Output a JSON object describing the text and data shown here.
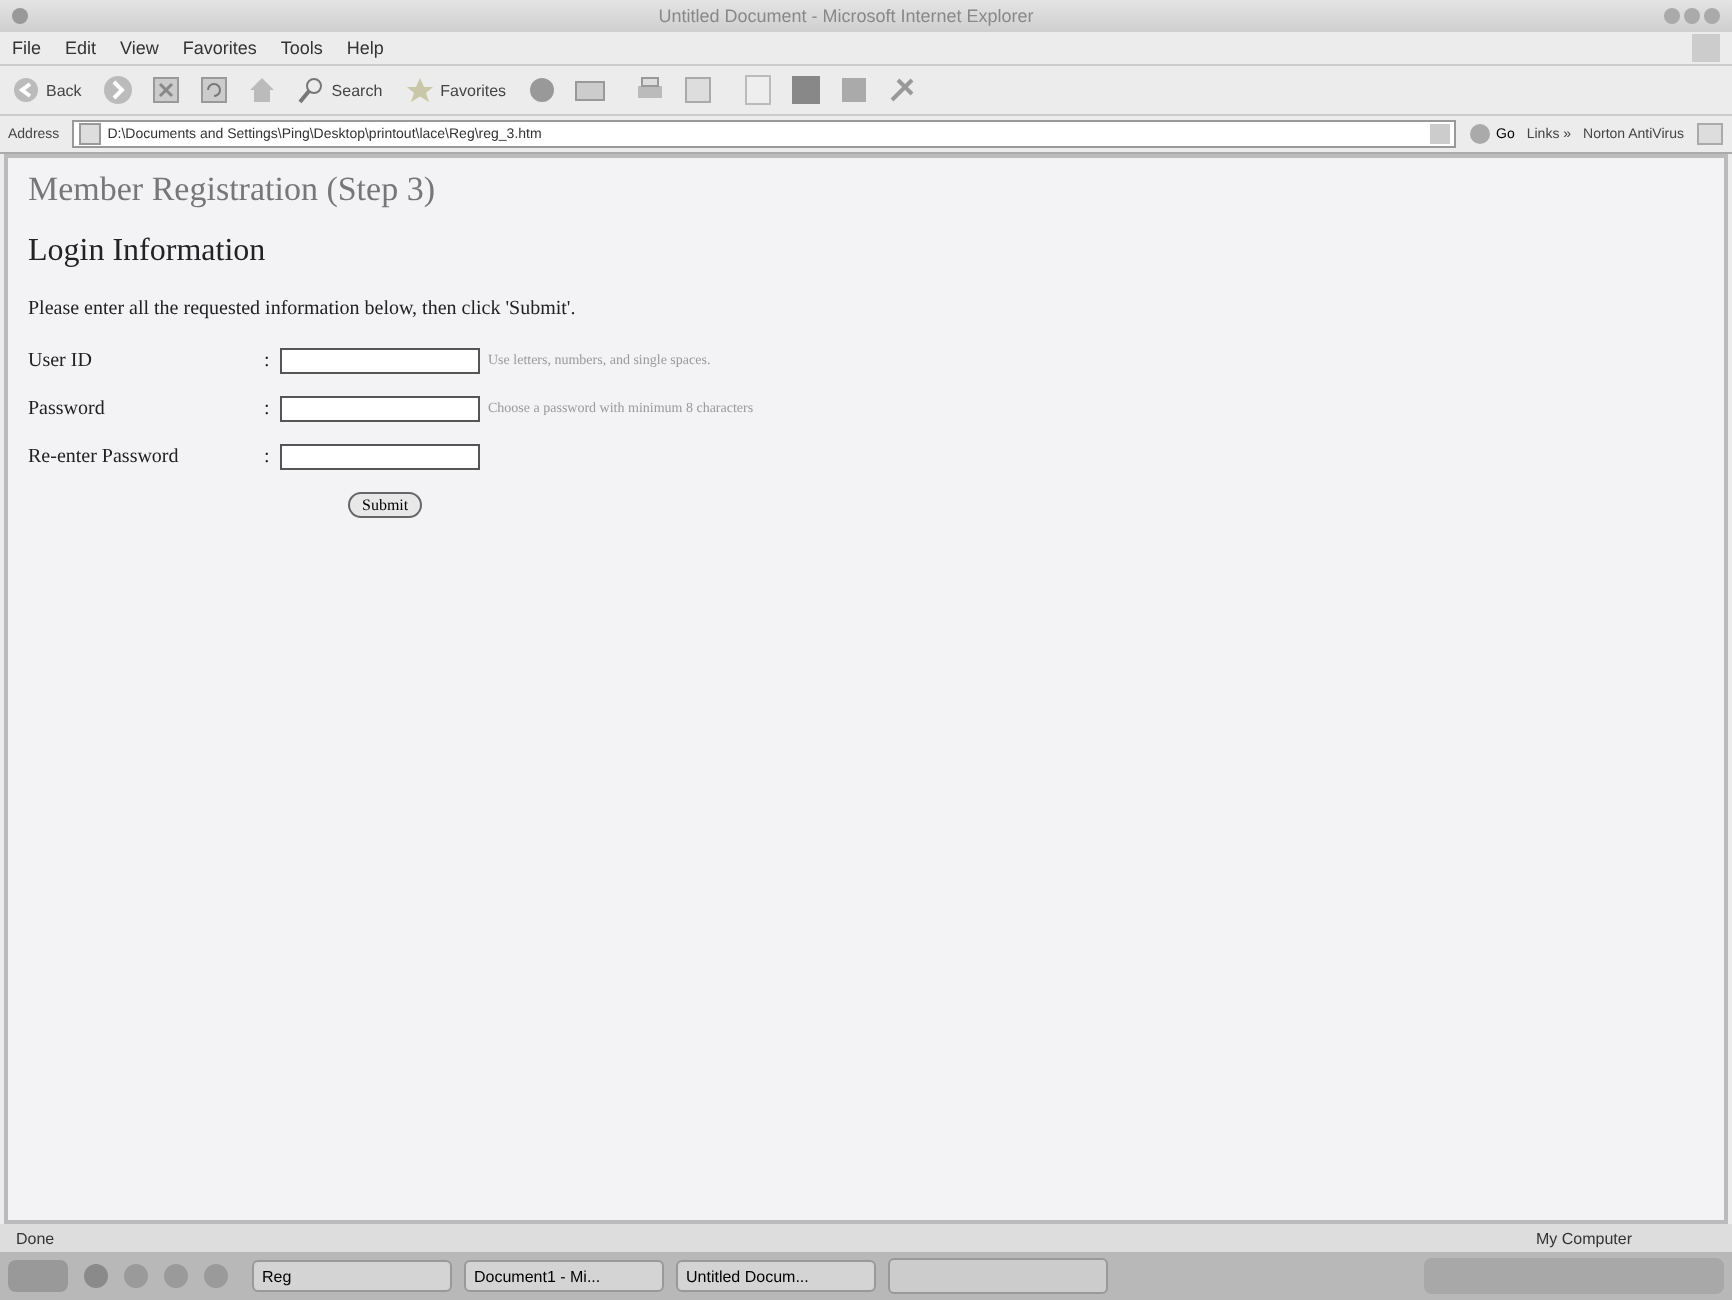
{
  "window": {
    "title": "Untitled Document - Microsoft Internet Explorer"
  },
  "menu": [
    "File",
    "Edit",
    "View",
    "Favorites",
    "Tools",
    "Help"
  ],
  "toolbar": {
    "back": "Back",
    "search": "Search",
    "favorites": "Favorites"
  },
  "address": {
    "label": "Address",
    "value": "D:\\Documents and Settings\\Ping\\Desktop\\printout\\lace\\Reg\\reg_3.htm",
    "go": "Go",
    "links": "Links",
    "links_arrow": "»",
    "norton": "Norton AntiVirus"
  },
  "page": {
    "title": "Member Registration (Step 3)",
    "heading": "Login Information",
    "intro": "Please enter all the requested information below, then click 'Submit'.",
    "fields": [
      {
        "label": "User ID",
        "separator": ":",
        "hint": "Use letters, numbers, and single spaces."
      },
      {
        "label": "Password",
        "separator": ":",
        "hint": "Choose a password with minimum 8 characters"
      },
      {
        "label": "Re-enter Password",
        "separator": ":"
      }
    ],
    "submit": "Submit"
  },
  "status_bar": {
    "left": "Done",
    "right": "My Computer"
  },
  "taskbar": [
    "Reg",
    "Document1 - Mi...",
    "Untitled Docum..."
  ]
}
